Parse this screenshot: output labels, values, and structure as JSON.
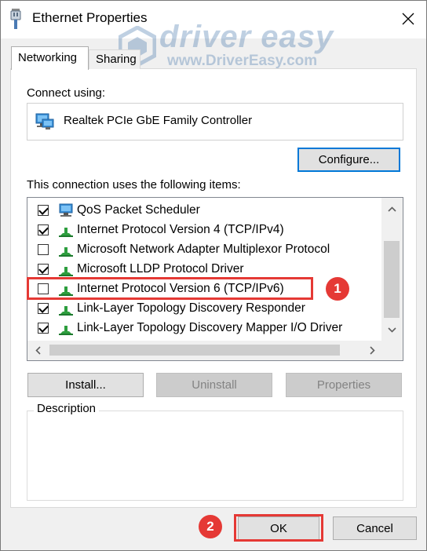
{
  "window": {
    "title": "Ethernet Properties"
  },
  "watermark": {
    "brand": "driver easy",
    "url": "www.DriverEasy.com"
  },
  "tabs": [
    {
      "label": "Networking",
      "active": true
    },
    {
      "label": "Sharing",
      "active": false
    }
  ],
  "connect_using_label": "Connect using:",
  "adapter_name": "Realtek PCIe GbE Family Controller",
  "configure_button": "Configure...",
  "items_label": "This connection uses the following items:",
  "items": [
    {
      "label": "QoS Packet Scheduler",
      "checked": true,
      "icon": "qos-scheduler-icon"
    },
    {
      "label": "Internet Protocol Version 4 (TCP/IPv4)",
      "checked": true,
      "icon": "protocol-icon"
    },
    {
      "label": "Microsoft Network Adapter Multiplexor Protocol",
      "checked": false,
      "icon": "protocol-icon"
    },
    {
      "label": "Microsoft LLDP Protocol Driver",
      "checked": true,
      "icon": "protocol-icon"
    },
    {
      "label": "Internet Protocol Version 6 (TCP/IPv6)",
      "checked": false,
      "icon": "protocol-icon"
    },
    {
      "label": "Link-Layer Topology Discovery Responder",
      "checked": true,
      "icon": "protocol-icon"
    },
    {
      "label": "Link-Layer Topology Discovery Mapper I/O Driver",
      "checked": true,
      "icon": "protocol-icon"
    }
  ],
  "buttons": {
    "install": "Install...",
    "uninstall": "Uninstall",
    "properties": "Properties",
    "ok": "OK",
    "cancel": "Cancel"
  },
  "description_label": "Description",
  "annotations": {
    "step1": "1",
    "step2": "2"
  },
  "colors": {
    "highlight": "#e53935",
    "accent": "#0078d7",
    "protocol_green": "#2e9e3f"
  }
}
